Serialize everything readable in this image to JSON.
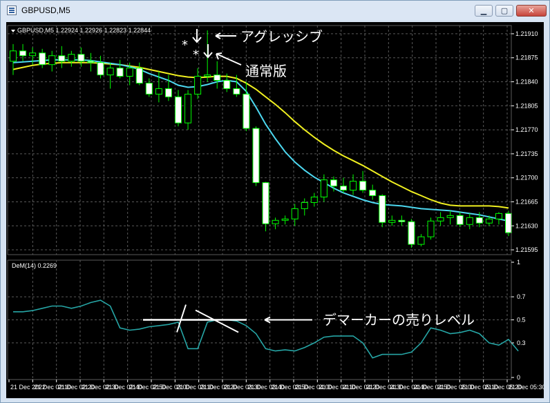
{
  "window": {
    "title": "GBPUSD,M5",
    "buttons": {
      "minimize": "▁",
      "maximize": "▢",
      "close": "✕"
    }
  },
  "colors": {
    "background": "#000000",
    "grid": "#5a5a5a",
    "text": "#ffffff",
    "candle_up_border": "#00ff00",
    "candle_down_fill": "#ffffff",
    "ma_fast": "#4dd8f0",
    "ma_slow": "#f0f020",
    "dem_line": "#26a6a6"
  },
  "chart_data": [
    {
      "type": "candlestick",
      "header": "GBPUSD,M5  1.22924 1.22926 1.22823 1.22844",
      "ylim": [
        1.21588,
        1.21922
      ],
      "y_ticks": [
        "1.21910",
        "1.21875",
        "1.21840",
        "1.21805",
        "1.21770",
        "1.21735",
        "1.21700",
        "1.21665",
        "1.21630",
        "1.21595"
      ],
      "x_ticks": [
        "21 Dec 2022",
        "21 Dec 02:10",
        "21 Dec 02:20",
        "21 Dec 02:30",
        "21 Dec 02:40",
        "21 Dec 02:50",
        "21 Dec 03:00",
        "21 Dec 03:10",
        "21 Dec 03:20",
        "21 Dec 03:30",
        "21 Dec 03:40",
        "21 Dec 03:50",
        "21 Dec 04:00",
        "21 Dec 04:10",
        "21 Dec 04:20",
        "21 Dec 04:30",
        "21 Dec 04:40",
        "21 Dec 04:50",
        "21 Dec 05:00",
        "21 Dec 05:10",
        "21 Dec 05:20",
        "21 Dec 05:30"
      ],
      "candles": [
        {
          "o": 1.2187,
          "h": 1.21895,
          "l": 1.2185,
          "c": 1.21885
        },
        {
          "o": 1.21885,
          "h": 1.21895,
          "l": 1.2187,
          "c": 1.21878
        },
        {
          "o": 1.21878,
          "h": 1.2189,
          "l": 1.21865,
          "c": 1.21882
        },
        {
          "o": 1.21882,
          "h": 1.21888,
          "l": 1.2186,
          "c": 1.21865
        },
        {
          "o": 1.21865,
          "h": 1.21885,
          "l": 1.21855,
          "c": 1.21878
        },
        {
          "o": 1.21878,
          "h": 1.21892,
          "l": 1.2186,
          "c": 1.2187
        },
        {
          "o": 1.2187,
          "h": 1.21885,
          "l": 1.21862,
          "c": 1.2188
        },
        {
          "o": 1.2188,
          "h": 1.2189,
          "l": 1.21862,
          "c": 1.2187
        },
        {
          "o": 1.2187,
          "h": 1.21882,
          "l": 1.21855,
          "c": 1.21868
        },
        {
          "o": 1.21868,
          "h": 1.21878,
          "l": 1.21845,
          "c": 1.2185
        },
        {
          "o": 1.2185,
          "h": 1.21868,
          "l": 1.2183,
          "c": 1.2186
        },
        {
          "o": 1.2186,
          "h": 1.21872,
          "l": 1.21845,
          "c": 1.21848
        },
        {
          "o": 1.21848,
          "h": 1.21868,
          "l": 1.21835,
          "c": 1.2186
        },
        {
          "o": 1.2186,
          "h": 1.21868,
          "l": 1.21835,
          "c": 1.21838
        },
        {
          "o": 1.21838,
          "h": 1.21845,
          "l": 1.21818,
          "c": 1.21822
        },
        {
          "o": 1.21822,
          "h": 1.21855,
          "l": 1.2181,
          "c": 1.2183
        },
        {
          "o": 1.2183,
          "h": 1.2185,
          "l": 1.21812,
          "c": 1.21818
        },
        {
          "o": 1.21818,
          "h": 1.21828,
          "l": 1.21775,
          "c": 1.2178
        },
        {
          "o": 1.2178,
          "h": 1.21828,
          "l": 1.2177,
          "c": 1.21822
        },
        {
          "o": 1.21822,
          "h": 1.2186,
          "l": 1.21815,
          "c": 1.21848
        },
        {
          "o": 1.21848,
          "h": 1.21915,
          "l": 1.2184,
          "c": 1.2185
        },
        {
          "o": 1.2185,
          "h": 1.2187,
          "l": 1.2183,
          "c": 1.21842
        },
        {
          "o": 1.21842,
          "h": 1.21852,
          "l": 1.21825,
          "c": 1.2183
        },
        {
          "o": 1.2183,
          "h": 1.2185,
          "l": 1.21818,
          "c": 1.21822
        },
        {
          "o": 1.21822,
          "h": 1.2184,
          "l": 1.21768,
          "c": 1.21772
        },
        {
          "o": 1.21772,
          "h": 1.21775,
          "l": 1.21688,
          "c": 1.21693
        },
        {
          "o": 1.21693,
          "h": 1.21694,
          "l": 1.21622,
          "c": 1.21633
        },
        {
          "o": 1.21633,
          "h": 1.21642,
          "l": 1.21625,
          "c": 1.21638
        },
        {
          "o": 1.21638,
          "h": 1.21645,
          "l": 1.21632,
          "c": 1.2164
        },
        {
          "o": 1.2164,
          "h": 1.21662,
          "l": 1.2163,
          "c": 1.21655
        },
        {
          "o": 1.21655,
          "h": 1.2167,
          "l": 1.21645,
          "c": 1.21664
        },
        {
          "o": 1.21664,
          "h": 1.21678,
          "l": 1.21658,
          "c": 1.21672
        },
        {
          "o": 1.21672,
          "h": 1.21705,
          "l": 1.21665,
          "c": 1.21697
        },
        {
          "o": 1.21697,
          "h": 1.21702,
          "l": 1.2168,
          "c": 1.21688
        },
        {
          "o": 1.21688,
          "h": 1.217,
          "l": 1.21678,
          "c": 1.21682
        },
        {
          "o": 1.21682,
          "h": 1.21705,
          "l": 1.21675,
          "c": 1.21695
        },
        {
          "o": 1.21695,
          "h": 1.2171,
          "l": 1.21678,
          "c": 1.21682
        },
        {
          "o": 1.21682,
          "h": 1.2169,
          "l": 1.21668,
          "c": 1.21674
        },
        {
          "o": 1.21674,
          "h": 1.21676,
          "l": 1.21628,
          "c": 1.21635
        },
        {
          "o": 1.21635,
          "h": 1.21645,
          "l": 1.2163,
          "c": 1.21638
        },
        {
          "o": 1.21638,
          "h": 1.21645,
          "l": 1.2163,
          "c": 1.21636
        },
        {
          "o": 1.21636,
          "h": 1.2164,
          "l": 1.21598,
          "c": 1.21603
        },
        {
          "o": 1.21603,
          "h": 1.21618,
          "l": 1.216,
          "c": 1.21614
        },
        {
          "o": 1.21614,
          "h": 1.21642,
          "l": 1.2161,
          "c": 1.21637
        },
        {
          "o": 1.21637,
          "h": 1.2165,
          "l": 1.2163,
          "c": 1.21642
        },
        {
          "o": 1.21642,
          "h": 1.21652,
          "l": 1.21632,
          "c": 1.21645
        },
        {
          "o": 1.21645,
          "h": 1.2165,
          "l": 1.21628,
          "c": 1.21632
        },
        {
          "o": 1.21632,
          "h": 1.21648,
          "l": 1.21625,
          "c": 1.21642
        },
        {
          "o": 1.21642,
          "h": 1.2165,
          "l": 1.21628,
          "c": 1.21634
        },
        {
          "o": 1.21634,
          "h": 1.21645,
          "l": 1.2163,
          "c": 1.2164
        },
        {
          "o": 1.2164,
          "h": 1.2165,
          "l": 1.21632,
          "c": 1.21648
        },
        {
          "o": 1.21648,
          "h": 1.21652,
          "l": 1.21615,
          "c": 1.2162
        }
      ],
      "ma_fast": [
        1.21868,
        1.21869,
        1.2187,
        1.21871,
        1.21872,
        1.21872,
        1.21872,
        1.21872,
        1.21871,
        1.21869,
        1.21867,
        1.21865,
        1.21862,
        1.21858,
        1.21852,
        1.21847,
        1.21842,
        1.21835,
        1.21832,
        1.21833,
        1.21836,
        1.2184,
        1.21842,
        1.2184,
        1.21826,
        1.21803,
        1.21778,
        1.21757,
        1.21738,
        1.21723,
        1.21711,
        1.21701,
        1.21693,
        1.21685,
        1.21678,
        1.21673,
        1.21668,
        1.21664,
        1.21661,
        1.2166,
        1.21659,
        1.21657,
        1.21655,
        1.21654,
        1.21653,
        1.21652,
        1.2165,
        1.21648,
        1.21646,
        1.21643,
        1.2164,
        1.21637
      ],
      "ma_slow": [
        1.21858,
        1.21861,
        1.21864,
        1.21866,
        1.21867,
        1.21868,
        1.21868,
        1.21868,
        1.21868,
        1.21867,
        1.21866,
        1.21865,
        1.21863,
        1.21861,
        1.21858,
        1.21855,
        1.21852,
        1.21849,
        1.21847,
        1.21846,
        1.21847,
        1.21848,
        1.21848,
        1.21845,
        1.21838,
        1.21829,
        1.21818,
        1.21807,
        1.21795,
        1.21782,
        1.2177,
        1.21759,
        1.21749,
        1.2174,
        1.21732,
        1.21725,
        1.21718,
        1.2171,
        1.21702,
        1.21694,
        1.21687,
        1.2168,
        1.21674,
        1.21668,
        1.21663,
        1.2166,
        1.21659,
        1.21659,
        1.21659,
        1.21659,
        1.21658,
        1.21656
      ]
    },
    {
      "type": "line",
      "header": "DeM(14) 0.2269",
      "ylim": [
        0,
        1
      ],
      "y_ticks": [
        "1",
        "0.7",
        "0.5",
        "0.3",
        "0"
      ],
      "values": [
        0.57,
        0.57,
        0.58,
        0.6,
        0.62,
        0.62,
        0.6,
        0.62,
        0.65,
        0.67,
        0.62,
        0.43,
        0.41,
        0.42,
        0.44,
        0.45,
        0.46,
        0.48,
        0.25,
        0.25,
        0.48,
        0.5,
        0.5,
        0.49,
        0.45,
        0.38,
        0.25,
        0.23,
        0.24,
        0.23,
        0.26,
        0.3,
        0.35,
        0.36,
        0.36,
        0.36,
        0.3,
        0.17,
        0.2,
        0.2,
        0.2,
        0.22,
        0.3,
        0.43,
        0.41,
        0.38,
        0.39,
        0.41,
        0.38,
        0.3,
        0.28,
        0.33,
        0.23
      ]
    }
  ],
  "annotations": {
    "aggressive": "アグレッシブ",
    "normal": "通常版",
    "dem_sell": "デマーカーの売りレベル"
  }
}
